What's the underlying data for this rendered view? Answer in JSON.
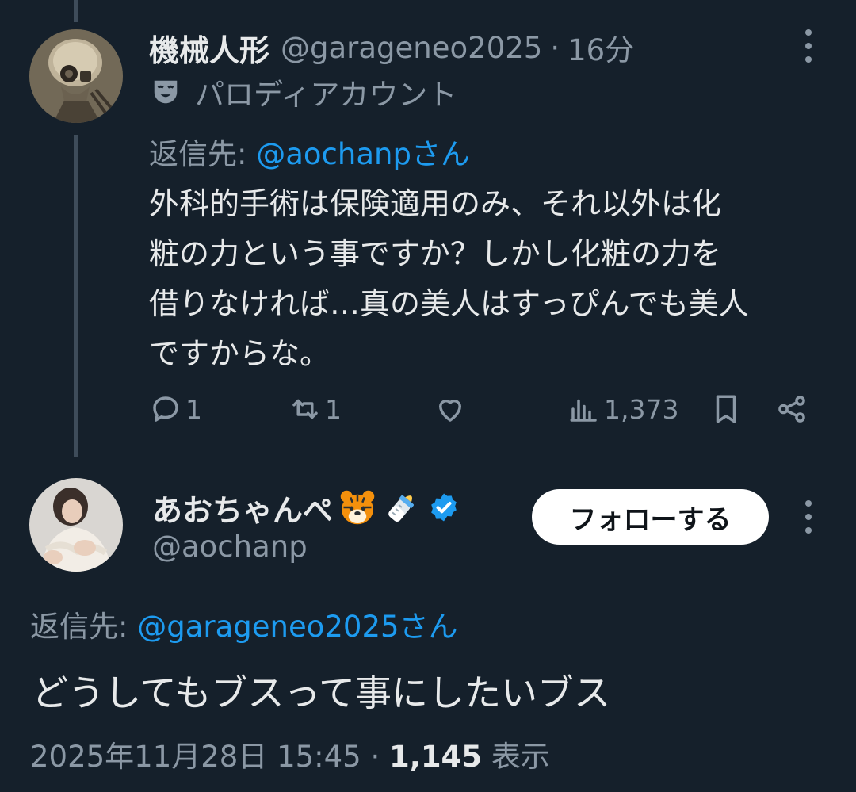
{
  "tweet1": {
    "author_name": "機械人形",
    "handle": "@garageneo2025",
    "separator": "·",
    "time": "16分",
    "parody_label": "パロディアカウント",
    "replying_prefix": "返信先: ",
    "replying_to": "@aochanpさん",
    "body_lines": [
      "外科的手術は保険適用のみ、それ以外は化",
      "粧の力という事ですか？しかし化粧の力を",
      "借りなければ…真の美人はすっぴんでも美人",
      "ですからな。"
    ],
    "reply_count": "1",
    "retweet_count": "1",
    "views_count": "1,373"
  },
  "tweet2": {
    "author_name": "あおちゃんぺ",
    "handle": "@aochanp",
    "follow_label": "フォローする",
    "replying_prefix": "返信先: ",
    "replying_to": "@garageneo2025さん",
    "body": "どうしてもブスって事にしたいブス",
    "timestamp": "2025年11月28日 15:45",
    "separator": "·",
    "view_count": "1,145",
    "view_label": "表示"
  },
  "icons": {
    "tweet1": [
      "avatar",
      "more-icon",
      "parody-mask-icon",
      "reply-icon",
      "retweet-icon",
      "like-icon",
      "views-icon",
      "bookmark-icon",
      "share-icon"
    ],
    "tweet2": [
      "avatar",
      "tiger-emoji-icon",
      "baby-bottle-emoji-icon",
      "verified-badge-icon",
      "more-icon"
    ]
  },
  "colors": {
    "background": "#15202b",
    "text": "#e7e9ea",
    "secondary": "#8b98a5",
    "link": "#1d9bf0",
    "verified": "#1d9bf0"
  }
}
